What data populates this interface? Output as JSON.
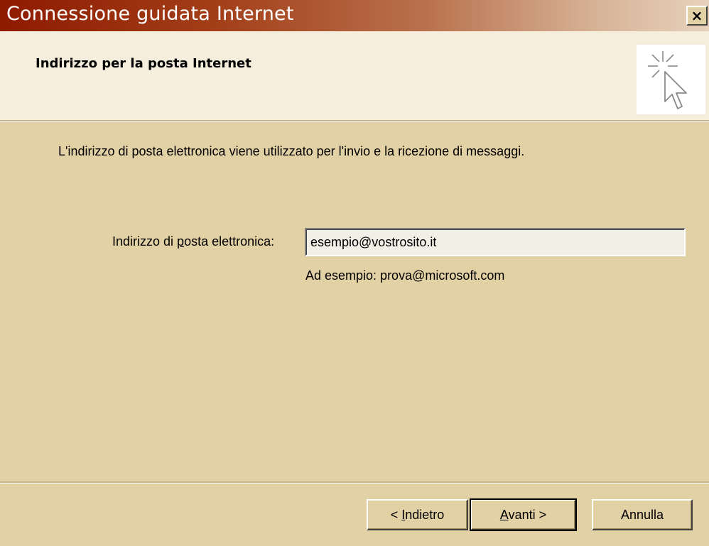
{
  "window": {
    "title": "Connessione guidata Internet",
    "close_label": "×"
  },
  "header": {
    "title": "Indirizzo per la posta Internet",
    "graphic_icon": "wizard-cursor-sparkle-icon"
  },
  "main": {
    "description": "L'indirizzo di posta elettronica viene utilizzato per l'invio e la ricezione di messaggi.",
    "email_label_pre": "Indirizzo di ",
    "email_label_mnemonic": "p",
    "email_label_post": "osta elettronica:",
    "email_value": "esempio@vostrosito.it",
    "example_text": "Ad esempio: prova@microsoft.com"
  },
  "footer": {
    "back_pre": "< ",
    "back_mnemonic": "I",
    "back_post": "ndietro",
    "next_mnemonic": "A",
    "next_post": "vanti >",
    "cancel_label": "Annulla"
  },
  "colors": {
    "title_gradient_start": "#8E1A00",
    "title_gradient_end": "#E7D1BC",
    "dialog_background": "#E3D1A6",
    "header_background": "#F5EEDC"
  }
}
